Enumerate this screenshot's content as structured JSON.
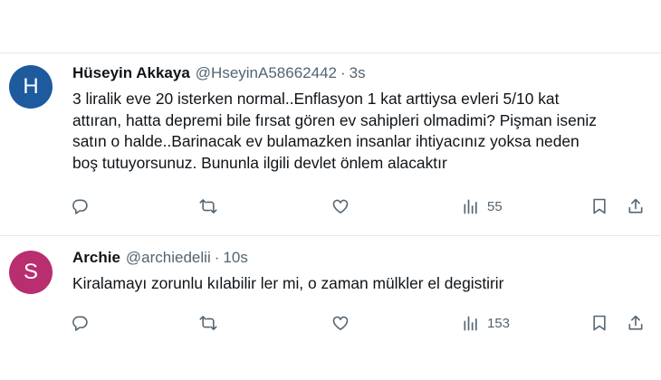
{
  "tweets": [
    {
      "avatar_letter": "H",
      "avatar_color": "#1d5b9e",
      "name": "Hüseyin Akkaya",
      "handle": "@HseyinA58662442",
      "separator": "·",
      "time": "3s",
      "text_lines": [
        "3 liralik eve 20 isterken normal..Enflasyon 1 kat arttiysa evleri 5/10 kat",
        "attıran, hatta depremi bile fırsat gören ev sahipleri olmadimi? Pişman iseniz",
        "satın o halde..Barinacak ev bulamazken insanlar ihtiyacınız yoksa neden",
        "boş tutuyorsunuz. Bununla ilgili devlet önlem alacaktır"
      ],
      "views": "55",
      "icons": [
        "reply-icon",
        "retweet-icon",
        "like-icon",
        "views-icon",
        "bookmark-icon",
        "share-icon"
      ]
    },
    {
      "avatar_letter": "S",
      "avatar_color": "#b82e6f",
      "name": "Archie",
      "handle": "@archiedelii",
      "separator": "·",
      "time": "10s",
      "text_lines": [
        "Kiralamayı zorunlu kılabilir ler mi, o zaman mülkler el degistirir"
      ],
      "views": "153",
      "icons": [
        "reply-icon",
        "retweet-icon",
        "like-icon",
        "views-icon",
        "bookmark-icon",
        "share-icon"
      ]
    }
  ],
  "colors": {
    "text": "#0f1419",
    "secondary": "#536471",
    "divider": "#e6e9eb"
  }
}
